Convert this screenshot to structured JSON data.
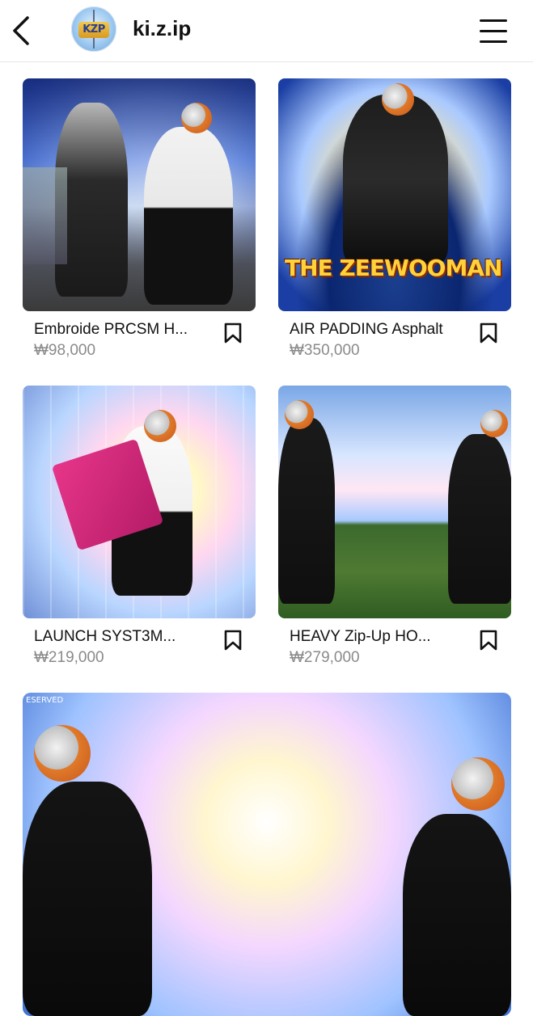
{
  "header": {
    "title": "ki.z.ip",
    "avatar_text": "KZP"
  },
  "products": [
    {
      "name": "Embroide PRCSM H...",
      "price": "₩98,000"
    },
    {
      "name": "AIR PADDING Asphalt",
      "price": "₩350,000"
    },
    {
      "name": "LAUNCH SYST3M...",
      "price": "₩219,000"
    },
    {
      "name": "HEAVY Zip-Up HO...",
      "price": "₩279,000"
    }
  ],
  "thumb_overlays": {
    "p2_banner": "THE ZEEWOOMAN",
    "p5_corner": "ESERVED"
  },
  "icons": [
    "back-arrow-icon",
    "hamburger-menu-icon",
    "bookmark-icon"
  ]
}
